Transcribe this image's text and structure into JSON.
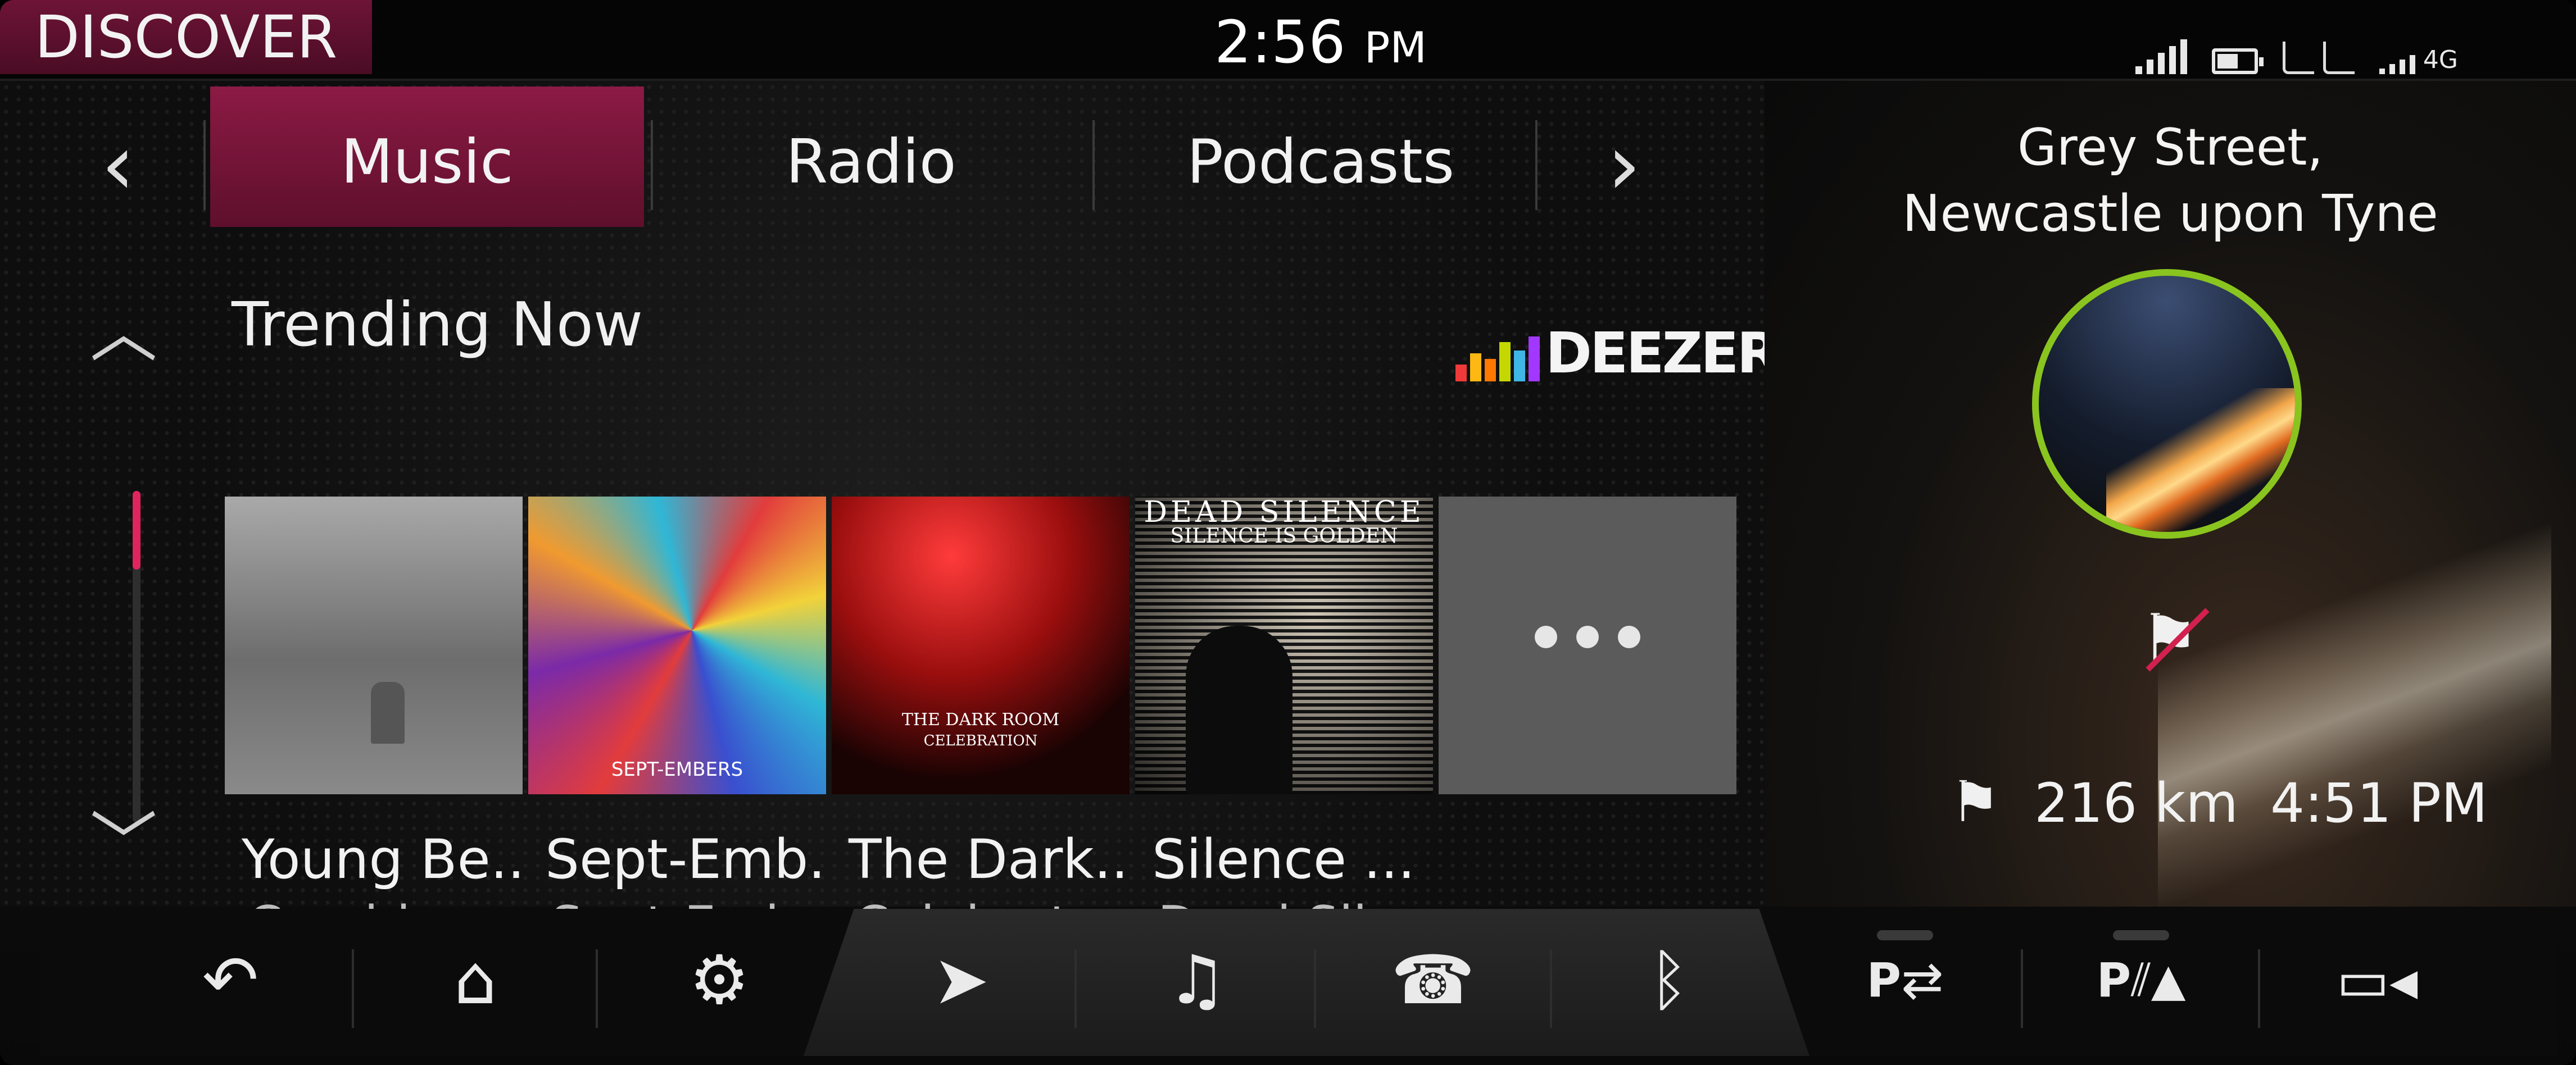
{
  "status_bar": {
    "screen_title": "DISCOVER",
    "time": "2:56",
    "time_suffix": "PM",
    "network": "4G"
  },
  "media": {
    "tabs": [
      {
        "label": "Music",
        "active": true
      },
      {
        "label": "Radio",
        "active": false
      },
      {
        "label": "Podcasts",
        "active": false
      }
    ],
    "section_title": "Trending Now",
    "provider": "DEEZER",
    "provider_colors": [
      "#ef3a39",
      "#fdb813",
      "#ff7800",
      "#c5d700",
      "#3fb6e6",
      "#a238ff"
    ],
    "items": [
      {
        "title": "Young Be..",
        "subtitle": "Corvidae",
        "art": "snow-landscape"
      },
      {
        "title": "Sept-Emb...",
        "subtitle": "Sept-Emb...",
        "art": "abstract-colorful",
        "art_text": "SEPT-EMBERS"
      },
      {
        "title": "The Dark...",
        "subtitle": "Celebrat...",
        "art": "red-crowd",
        "art_text_1": "THE DARK ROOM",
        "art_text_2": "CELEBRATION"
      },
      {
        "title": "Silence ...",
        "subtitle": "Dead Sil...",
        "art": "guitarist-silhouette",
        "art_text_1": "DEAD SILENCE",
        "art_text_2": "SILENCE IS GOLDEN"
      }
    ],
    "more_label": "more",
    "page_dot_colors": [
      "#d2204f",
      "#f07a1f",
      "#8ac41f",
      "#1e3a6e",
      "#9a9a9a"
    ]
  },
  "navigation": {
    "location_line1": "Grey Street,",
    "location_line2": "Newcastle upon Tyne",
    "distance": "216 km",
    "eta": "4:51 PM",
    "ring_color": "#8ac41f"
  },
  "dock": {
    "items": [
      "back-icon",
      "home-icon",
      "settings-icon",
      "navigation-icon",
      "media-icon",
      "phone-icon",
      "bluetooth-icon",
      "park-assist-icon",
      "parking-sensors-icon",
      "camera-icon"
    ],
    "park_label": "P",
    "sensors_label": "P"
  }
}
